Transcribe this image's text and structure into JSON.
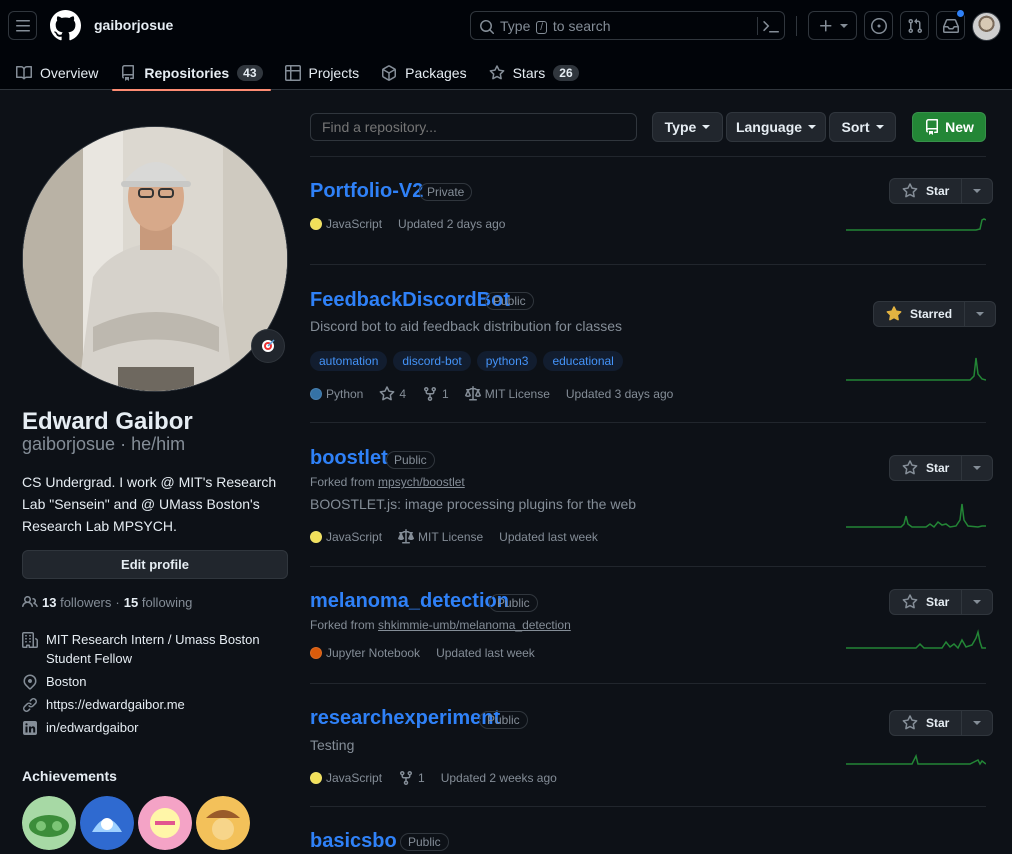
{
  "header": {
    "username": "gaiborjosue",
    "search_prefix": "Type",
    "search_key": "/",
    "search_suffix": "to search"
  },
  "tabs": [
    {
      "label": "Overview"
    },
    {
      "label": "Repositories",
      "count": "43"
    },
    {
      "label": "Projects"
    },
    {
      "label": "Packages"
    },
    {
      "label": "Stars",
      "count": "26"
    }
  ],
  "profile": {
    "name": "Edward Gaibor",
    "login": "gaiborjosue · he/him",
    "bio": "CS Undergrad. I work @ MIT's Research Lab \"Sensein\" and @ UMass Boston's Research Lab MPSYCH.",
    "edit_label": "Edit profile",
    "followers_count": "13",
    "followers_label": "followers",
    "following_count": "15",
    "following_label": "following",
    "organization": "MIT Research Intern / Umass Boston Student Fellow",
    "location": "Boston",
    "website": "https://edwardgaibor.me",
    "linkedin": "in/edwardgaibor",
    "achievements_title": "Achievements"
  },
  "toolbar": {
    "find_placeholder": "Find a repository...",
    "type_label": "Type",
    "language_label": "Language",
    "sort_label": "Sort",
    "new_label": "New"
  },
  "repos": [
    {
      "name": "Portfolio-V2",
      "visibility": "Private",
      "language": "JavaScript",
      "lang_color": "#f1e05a",
      "updated": "Updated 2 days ago",
      "star_label": "Star",
      "starred": false
    },
    {
      "name": "FeedbackDiscordBot",
      "visibility": "Public",
      "description": "Discord bot to aid feedback distribution for classes",
      "topics": [
        "automation",
        "discord-bot",
        "python3",
        "educational"
      ],
      "language": "Python",
      "lang_color": "#3572A5",
      "stars": "4",
      "forks": "1",
      "license": "MIT License",
      "updated": "Updated 3 days ago",
      "star_label": "Starred",
      "starred": true
    },
    {
      "name": "boostlet",
      "visibility": "Public",
      "forked_prefix": "Forked from",
      "forked_from": "mpsych/boostlet",
      "description": "BOOSTLET.js: image processing plugins for the web",
      "language": "JavaScript",
      "lang_color": "#f1e05a",
      "license": "MIT License",
      "updated": "Updated last week",
      "star_label": "Star",
      "starred": false
    },
    {
      "name": "melanoma_detection",
      "visibility": "Public",
      "forked_prefix": "Forked from",
      "forked_from": "shkimmie-umb/melanoma_detection",
      "language": "Jupyter Notebook",
      "lang_color": "#DA5B0B",
      "updated": "Updated last week",
      "star_label": "Star",
      "starred": false
    },
    {
      "name": "researchexperiment",
      "visibility": "Public",
      "description": "Testing",
      "language": "JavaScript",
      "lang_color": "#f1e05a",
      "forks": "1",
      "updated": "Updated 2 weeks ago",
      "star_label": "Star",
      "starred": false
    },
    {
      "name": "basicsbo",
      "visibility": "Public"
    }
  ],
  "colors": {
    "accent": "#2f81f7",
    "green": "#238636",
    "tab_underline": "#fd8c73",
    "spark": "#238636"
  }
}
